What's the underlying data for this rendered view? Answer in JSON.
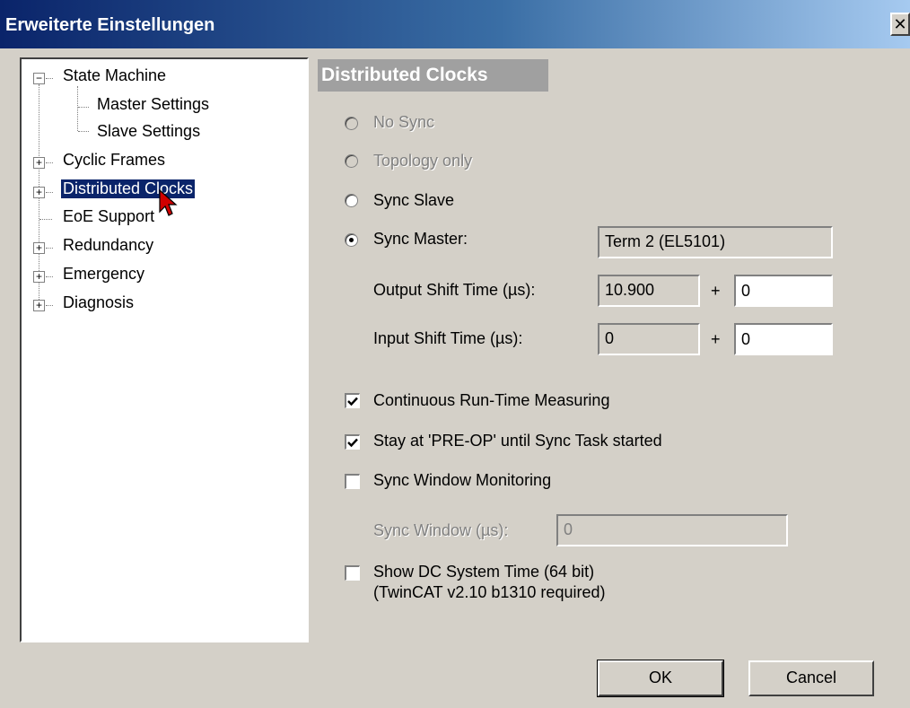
{
  "window": {
    "title": "Erweiterte Einstellungen",
    "close_glyph": "✕"
  },
  "tree": {
    "items": [
      {
        "label": "State Machine",
        "expander": "−"
      },
      {
        "label": "Master Settings"
      },
      {
        "label": "Slave Settings"
      },
      {
        "label": "Cyclic Frames",
        "expander": "+"
      },
      {
        "label": "Distributed Clocks",
        "expander": "+",
        "selected": true
      },
      {
        "label": "EoE Support"
      },
      {
        "label": "Redundancy",
        "expander": "+"
      },
      {
        "label": "Emergency",
        "expander": "+"
      },
      {
        "label": "Diagnosis",
        "expander": "+"
      }
    ]
  },
  "panel": {
    "title": "Distributed Clocks",
    "radio_no_sync": "No Sync",
    "radio_topology_only": "Topology only",
    "radio_sync_slave": "Sync Slave",
    "radio_sync_master": "Sync Master:",
    "sync_master_value": "Term 2 (EL5101)",
    "output_shift_label": "Output Shift Time (µs):",
    "output_shift_value": "10.900",
    "output_shift_plus": "+",
    "output_shift_offset": "0",
    "input_shift_label": "Input Shift Time (µs):",
    "input_shift_value": "0",
    "input_shift_plus": "+",
    "input_shift_offset": "0",
    "check_continuous": "Continuous Run-Time Measuring",
    "check_continuous_checked": true,
    "check_preop": "Stay at 'PRE-OP' until Sync Task started",
    "check_preop_checked": true,
    "check_sync_window": "Sync Window Monitoring",
    "check_sync_window_checked": false,
    "sync_window_label": "Sync Window (µs):",
    "sync_window_value": "0",
    "check_dc_time_line1": "Show DC System Time (64 bit)",
    "check_dc_time_line2": "(TwinCAT  v2.10 b1310 required)",
    "check_dc_time_checked": false
  },
  "buttons": {
    "ok": "OK",
    "cancel": "Cancel"
  }
}
